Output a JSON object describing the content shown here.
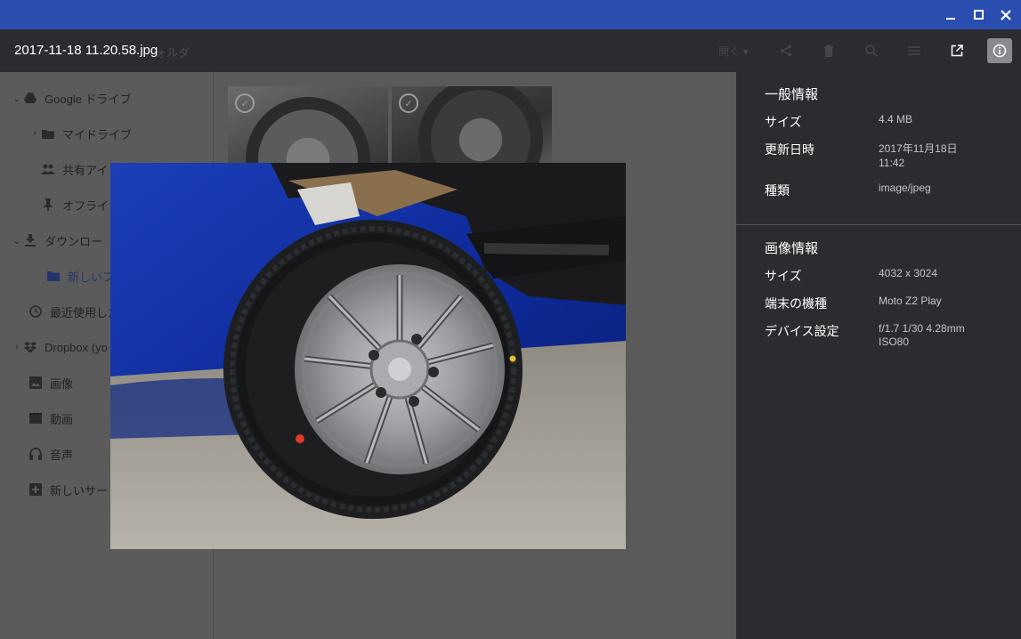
{
  "file_name": "2017-11-18 11.20.58.jpg",
  "ghost_header": {
    "breadcrumb": "ォルダ",
    "open_label": "開く ▾"
  },
  "sidebar": {
    "items": [
      {
        "label": "Google ドライブ",
        "icon": "google-drive-icon"
      },
      {
        "label": "マイドライブ",
        "icon": "my-drive-icon"
      },
      {
        "label": "共有アイ",
        "icon": "shared-people-icon"
      },
      {
        "label": "オフライ",
        "icon": "pin-icon"
      },
      {
        "label": "ダウンロー",
        "icon": "download-icon"
      },
      {
        "label": "新しいフ",
        "icon": "folder-icon"
      },
      {
        "label": "最近使用した",
        "icon": "clock-icon"
      },
      {
        "label": "Dropbox (yo",
        "icon": "dropbox-icon"
      },
      {
        "label": "画像",
        "icon": "image-icon"
      },
      {
        "label": "動画",
        "icon": "video-icon"
      },
      {
        "label": "音声",
        "icon": "audio-icon"
      },
      {
        "label": "新しいサー",
        "icon": "add-service-icon"
      }
    ]
  },
  "info_panel": {
    "general": {
      "title": "一般情報",
      "size_label": "サイズ",
      "size_value": "4.4 MB",
      "modified_label": "更新日時",
      "modified_date": "2017年11月18日",
      "modified_time": "11:42",
      "type_label": "種類",
      "type_value": "image/jpeg"
    },
    "image": {
      "title": "画像情報",
      "dimensions_label": "サイズ",
      "dimensions_value": "4032 x 3024",
      "model_label": "端末の機種",
      "model_value": "Moto Z2 Play",
      "settings_label": "デバイス設定",
      "settings_line1": "f/1.7 1/30 4.28mm",
      "settings_line2": "ISO80"
    }
  },
  "colors": {
    "titlebar": "#2a4eb0",
    "header": "#2b2c2f",
    "panel": "#2b2c2f",
    "dim_background": "#5a5a5a"
  }
}
